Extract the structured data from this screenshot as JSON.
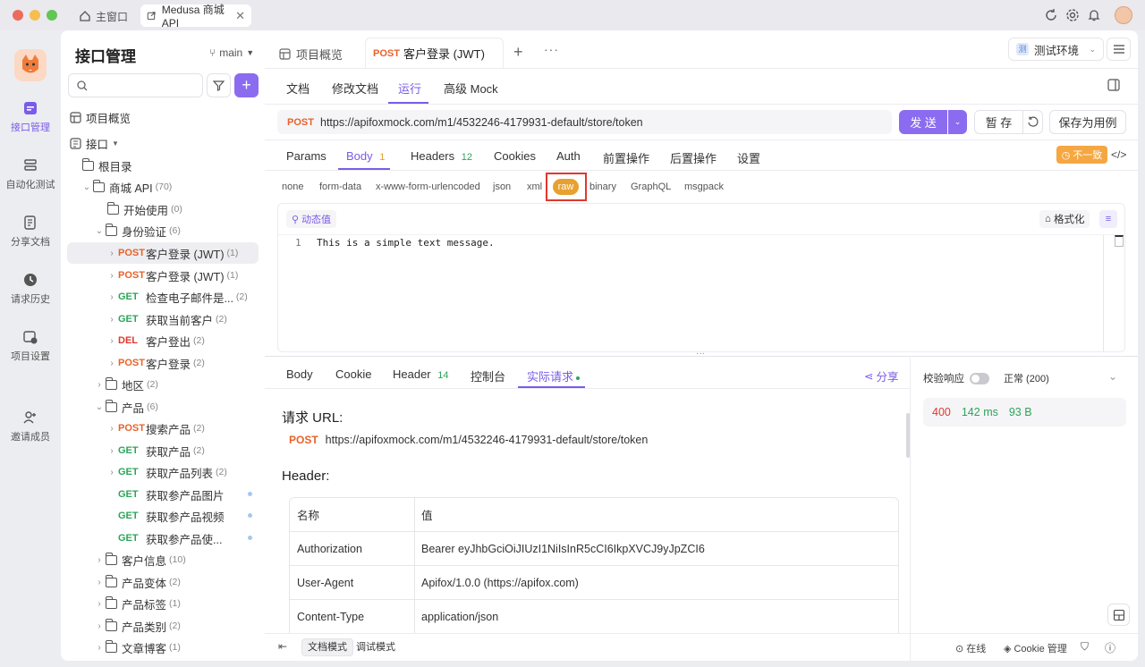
{
  "tabs": {
    "home": "主窗口",
    "active": "Medusa 商城 API"
  },
  "rail": [
    {
      "label": "接口管理",
      "icon": "api-icon"
    },
    {
      "label": "自动化测试",
      "icon": "layers-icon"
    },
    {
      "label": "分享文档",
      "icon": "doc-share-icon"
    },
    {
      "label": "请求历史",
      "icon": "history-icon"
    },
    {
      "label": "项目设置",
      "icon": "settings-icon"
    },
    {
      "label": "邀请成员",
      "icon": "add-user-icon"
    }
  ],
  "sidebar": {
    "title": "接口管理",
    "branch": "main",
    "search_placeholder": "",
    "overview": "项目概览",
    "api_root": "接口",
    "tree": [
      {
        "label": "根目录"
      },
      {
        "label": "商城 API",
        "count": "(70)"
      },
      {
        "label": "开始使用",
        "count": "(0)"
      },
      {
        "label": "身份验证",
        "count": "(6)"
      },
      {
        "method": "POST",
        "label": "客户登录 (JWT)",
        "count": "(1)"
      },
      {
        "method": "POST",
        "label": "客户登录 (JWT)",
        "count": "(1)"
      },
      {
        "method": "GET",
        "label": "检查电子邮件是...",
        "count": "(2)"
      },
      {
        "method": "GET",
        "label": "获取当前客户",
        "count": "(2)"
      },
      {
        "method": "DEL",
        "label": "客户登出",
        "count": "(2)"
      },
      {
        "method": "POST",
        "label": "客户登录",
        "count": "(2)"
      },
      {
        "label": "地区",
        "count": "(2)"
      },
      {
        "label": "产品",
        "count": "(6)"
      },
      {
        "method": "POST",
        "label": "搜索产品",
        "count": "(2)"
      },
      {
        "method": "GET",
        "label": "获取产品",
        "count": "(2)"
      },
      {
        "method": "GET",
        "label": "获取产品列表",
        "count": "(2)"
      },
      {
        "method": "GET",
        "label": "获取参产品图片",
        "count": ""
      },
      {
        "method": "GET",
        "label": "获取参产品视频",
        "count": ""
      },
      {
        "method": "GET",
        "label": "获取参产品使...",
        "count": ""
      },
      {
        "label": "客户信息",
        "count": "(10)"
      },
      {
        "label": "产品变体",
        "count": "(2)"
      },
      {
        "label": "产品标签",
        "count": "(1)"
      },
      {
        "label": "产品类别",
        "count": "(2)"
      },
      {
        "label": "文章博客",
        "count": "(1)"
      }
    ]
  },
  "doc_tabs": {
    "overview": "项目概览",
    "active_method": "POST",
    "active_label": "客户登录 (JWT)",
    "env": "测试环境"
  },
  "sub_tabs": [
    "文档",
    "修改文档",
    "运行",
    "高级 Mock"
  ],
  "request": {
    "method": "POST",
    "url": "https://apifoxmock.com/m1/4532246-4179931-default/store/token",
    "send": "发 送",
    "save_temp": "暂 存",
    "save_case": "保存为用例"
  },
  "param_tabs": [
    {
      "label": "Params"
    },
    {
      "label": "Body",
      "badge": "1"
    },
    {
      "label": "Headers",
      "badge": "12"
    },
    {
      "label": "Cookies"
    },
    {
      "label": "Auth"
    },
    {
      "label": "前置操作"
    },
    {
      "label": "后置操作"
    },
    {
      "label": "设置"
    }
  ],
  "mismatch": "不一致",
  "body_types": [
    "none",
    "form-data",
    "x-www-form-urlencoded",
    "json",
    "xml",
    "raw",
    "binary",
    "GraphQL",
    "msgpack"
  ],
  "editor": {
    "dynamic": "动态值",
    "format": "格式化",
    "line_no": "1",
    "line_text": "This is a simple text message."
  },
  "resp_tabs": [
    {
      "label": "Body"
    },
    {
      "label": "Cookie"
    },
    {
      "label": "Header",
      "badge": "14"
    },
    {
      "label": "控制台"
    },
    {
      "label": "实际请求"
    }
  ],
  "share": "分享",
  "actual": {
    "url_title": "请求 URL:",
    "method": "POST",
    "url": "https://apifoxmock.com/m1/4532246-4179931-default/store/token",
    "header_title": "Header:",
    "col_name": "名称",
    "col_value": "值",
    "rows": [
      {
        "name": "Authorization",
        "value": "Bearer eyJhbGciOiJIUzI1NiIsInR5cCI6IkpXVCJ9yJpZCI6"
      },
      {
        "name": "User-Agent",
        "value": "Apifox/1.0.0 (https://apifox.com)"
      },
      {
        "name": "Content-Type",
        "value": "application/json"
      }
    ]
  },
  "validate": {
    "label": "校验响应",
    "status": "正常 (200)",
    "code": "400",
    "time": "142 ms",
    "size": "93 B"
  },
  "status_bar": {
    "doc_mode": "文档模式",
    "debug_mode": "调试模式",
    "online": "在线",
    "cookie": "Cookie 管理"
  },
  "colors": {
    "accent": "#7a5ce8",
    "post": "#e8622a",
    "get": "#2ca45a",
    "del": "#e0382e",
    "highlight_box": "#e0382e"
  }
}
